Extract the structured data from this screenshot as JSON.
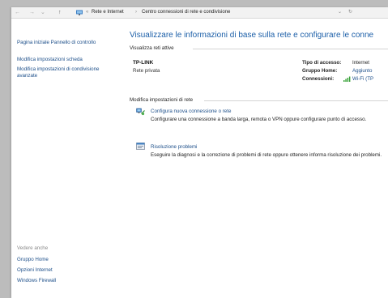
{
  "address_bar": {
    "back_glyph": "←",
    "forward_glyph": "→",
    "up_glyph": "↑",
    "breadcrumb": [
      "Rete e Internet",
      "Centro connessioni di rete e condivisione"
    ],
    "separator": "›",
    "leading_separator": "«",
    "dropdown_glyph": "⌄",
    "refresh_glyph": "↻"
  },
  "left_panel": {
    "home_link": "Pagina iniziale Pannello di controllo",
    "links": [
      "Modifica impostazioni scheda",
      "Modifica impostazioni di condivisione avanzate"
    ],
    "see_also_title": "Vedere anche",
    "see_also": [
      "Gruppo Home",
      "Opzioni Internet",
      "Windows Firewall"
    ]
  },
  "main": {
    "title": "Visualizzare le informazioni di base sulla rete e configurare le conne",
    "active_networks": {
      "heading": "Visualizza reti attive",
      "network_name": "TP-LINK",
      "network_type": "Rete privata",
      "access_type_label": "Tipo di accesso:",
      "access_type_value": "Internet",
      "homegroup_label": "Gruppo Home:",
      "homegroup_value": "Aggiunto",
      "connections_label": "Connessioni:",
      "connections_value": "Wi-Fi (TP"
    },
    "change_settings": {
      "heading": "Modifica impostazioni di rete",
      "tasks": [
        {
          "icon": "network-setup-icon",
          "link": "Configura nuova connessione o rete",
          "desc": "Configurare una connessione a banda larga, remota o VPN oppure configurare punto di accesso."
        },
        {
          "icon": "troubleshoot-icon",
          "link": "Risoluzione problemi",
          "desc": "Eseguire la diagnosi e la correzione di problemi di rete oppure ottenere informa risoluzione dei problemi."
        }
      ]
    }
  },
  "colors": {
    "link": "#1d4f8a",
    "title": "#1c5fa8",
    "wifi_signal": "#3aa33a"
  }
}
